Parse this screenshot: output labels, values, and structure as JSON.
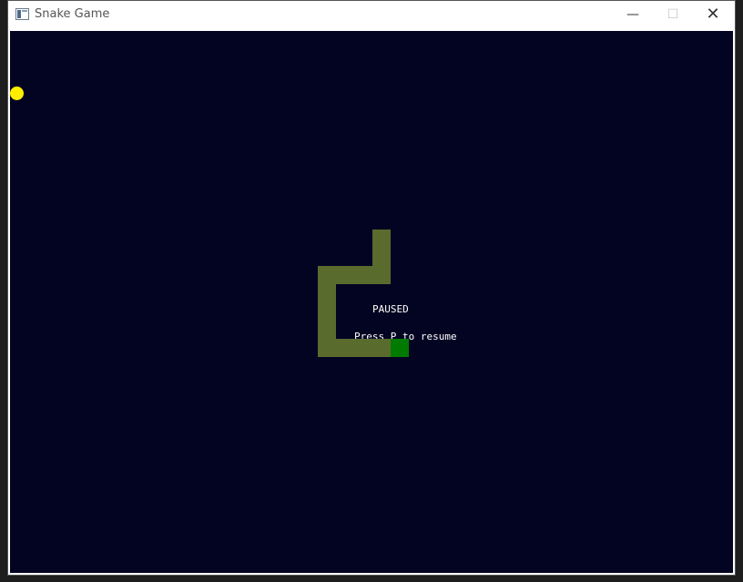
{
  "window": {
    "title": "Snake Game",
    "icon": "app-window-icon",
    "controls": {
      "minimize": "—",
      "maximize": "☐",
      "close": "✕"
    }
  },
  "game": {
    "state": "paused",
    "colors": {
      "background": "#030322",
      "snake_body": "#5a6b2e",
      "snake_head": "#007a00",
      "food": "#ffee00",
      "text": "#ffffff"
    },
    "grid_cell": 20,
    "snake_cells": [
      [
        20,
        10
      ],
      [
        20,
        11
      ],
      [
        20,
        12
      ],
      [
        19,
        12
      ],
      [
        18,
        12
      ],
      [
        17,
        12
      ],
      [
        17,
        13
      ],
      [
        17,
        14
      ],
      [
        17,
        15
      ],
      [
        17,
        16
      ],
      [
        18,
        16
      ],
      [
        19,
        16
      ],
      [
        20,
        16
      ]
    ],
    "snake_head_cell": [
      21,
      16
    ],
    "food_cell": [
      0,
      2
    ],
    "pause_title": "PAUSED",
    "pause_hint": "Press P to resume"
  }
}
